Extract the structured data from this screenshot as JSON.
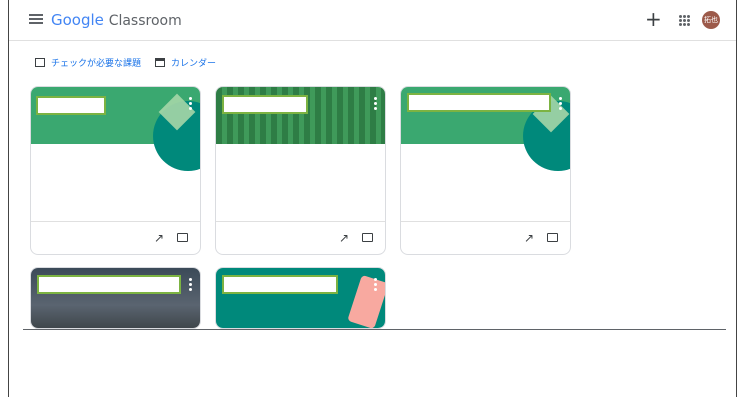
{
  "app": {
    "brand_google": "Google",
    "brand_product": "Classroom",
    "avatar_text": "拓也"
  },
  "header": {
    "add_symbol": "+"
  },
  "links": {
    "todo_label": "チェックが必要な課題",
    "calendar_label": "カレンダー"
  },
  "cards": [
    {
      "banner": "#3aa870"
    },
    {
      "banner": "#2e8b4e"
    },
    {
      "banner": "#3aa870"
    },
    {
      "banner": "#4a5560"
    },
    {
      "banner": "#00897b"
    }
  ],
  "footer_icons": {
    "trend": "↗"
  }
}
